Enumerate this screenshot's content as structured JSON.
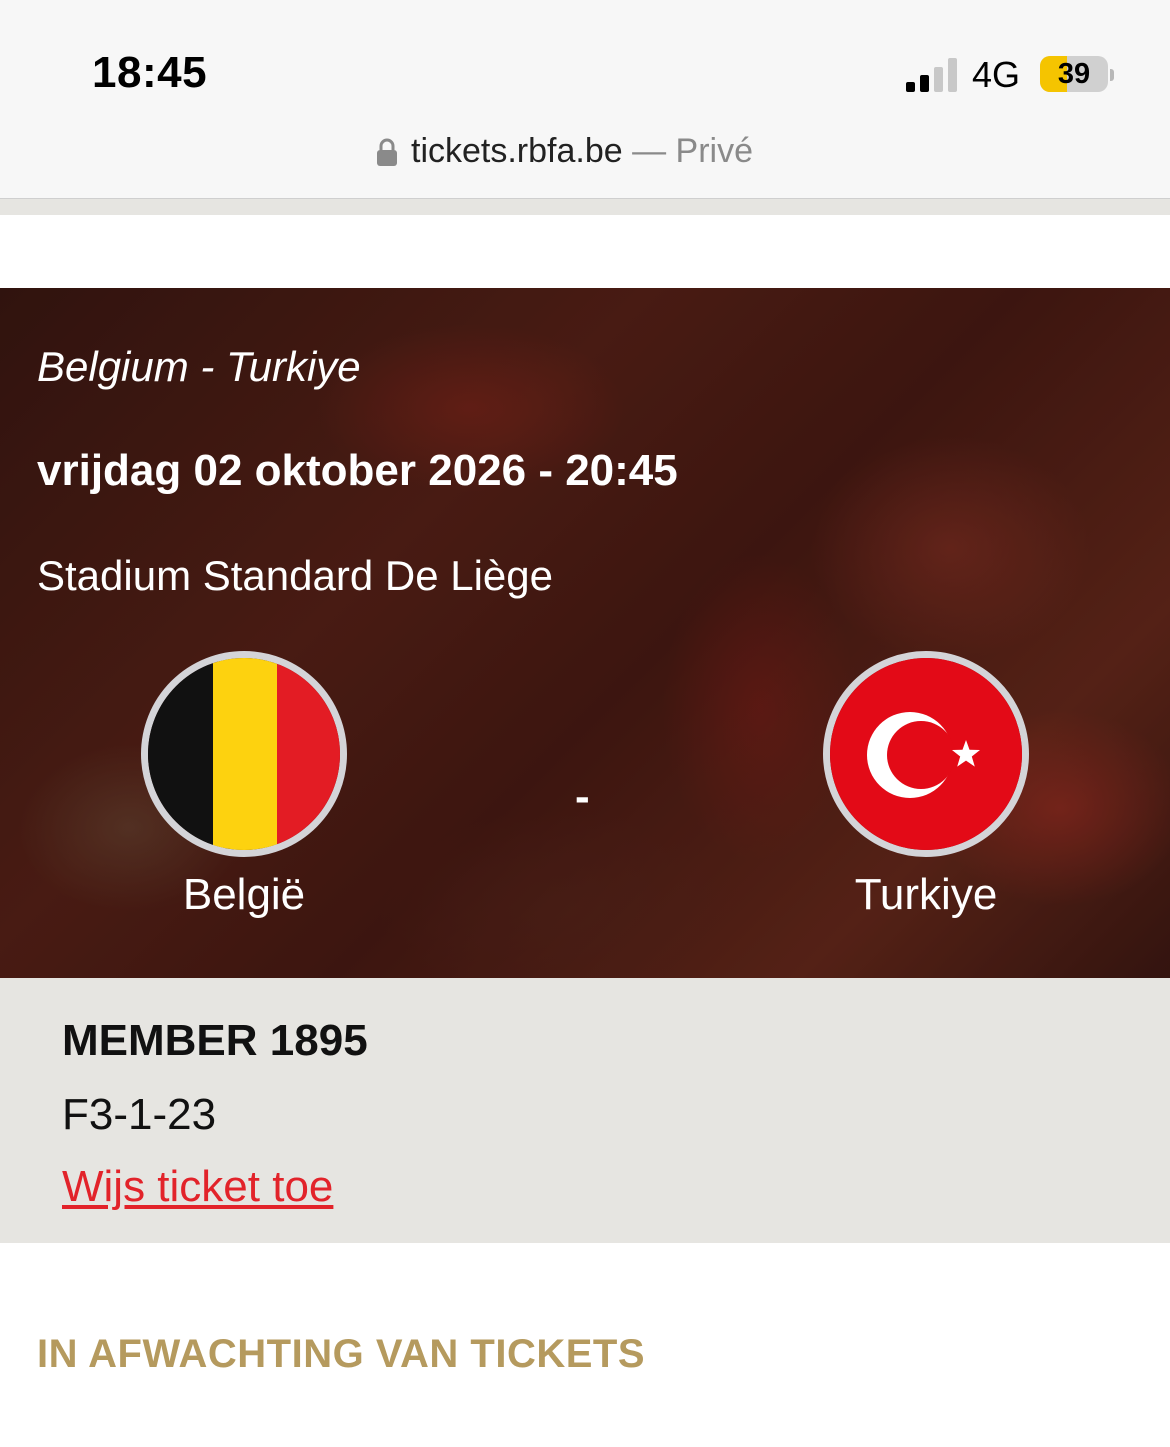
{
  "status_bar": {
    "time": "18:45",
    "network": "4G",
    "battery_percent": "39",
    "battery_level": 0.39,
    "battery_color": "#f5c400"
  },
  "address_bar": {
    "domain": "tickets.rbfa.be",
    "suffix": " — Privé",
    "icon": "lock-icon"
  },
  "match": {
    "name": "Belgium - Turkiye",
    "date": "vrijdag 02 oktober 2026 - 20:45",
    "venue": "Stadium Standard De Liège",
    "separator": "-",
    "home_team": {
      "name": "België",
      "flag_icon": "belgium-flag-icon"
    },
    "away_team": {
      "name": "Turkiye",
      "flag_icon": "turkey-flag-icon"
    }
  },
  "ticket": {
    "type": "MEMBER 1895",
    "seat": "F3-1-23",
    "show_link": "Wijs ticket toe",
    "link_color": "#e2232a"
  },
  "section": {
    "pending_heading": "IN AFWACHTING VAN TICKETS",
    "heading_color": "#b59a5e"
  }
}
